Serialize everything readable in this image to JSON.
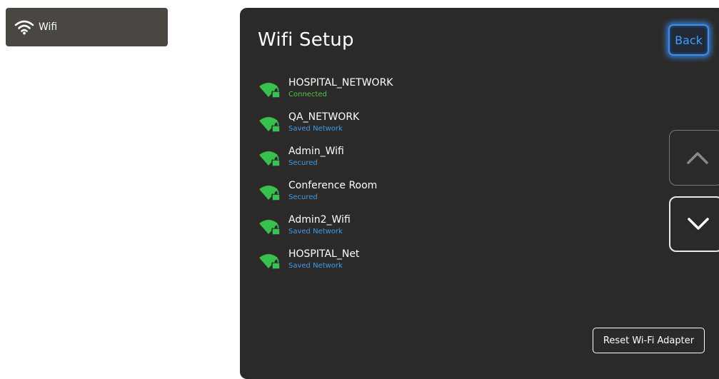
{
  "sidebar": {
    "wifi_tab": {
      "label": "Wifi",
      "icon": "wifi-icon"
    }
  },
  "panel": {
    "title": "Wifi Setup",
    "back_label": "Back",
    "reset_label": "Reset Wi-Fi Adapter",
    "scroll_up_icon": "chevron-up-icon",
    "scroll_down_icon": "chevron-down-icon"
  },
  "networks": [
    {
      "name": "HOSPITAL_NETWORK",
      "status": "Connected",
      "status_color": "#4cc94a"
    },
    {
      "name": "QA_NETWORK",
      "status": "Saved Network",
      "status_color": "#3a9cf0"
    },
    {
      "name": "Admin_Wifi",
      "status": "Secured",
      "status_color": "#3a9cf0"
    },
    {
      "name": "Conference Room",
      "status": "Secured",
      "status_color": "#3a9cf0"
    },
    {
      "name": "Admin2_Wifi",
      "status": "Saved Network",
      "status_color": "#3a9cf0"
    },
    {
      "name": "HOSPITAL_Net",
      "status": "Saved Network",
      "status_color": "#3a9cf0"
    }
  ],
  "colors": {
    "panel_bg": "#2b2a28",
    "tab_bg": "#4a4743",
    "signal_green": "#37c24f",
    "accent_blue": "#3a8cf7"
  }
}
